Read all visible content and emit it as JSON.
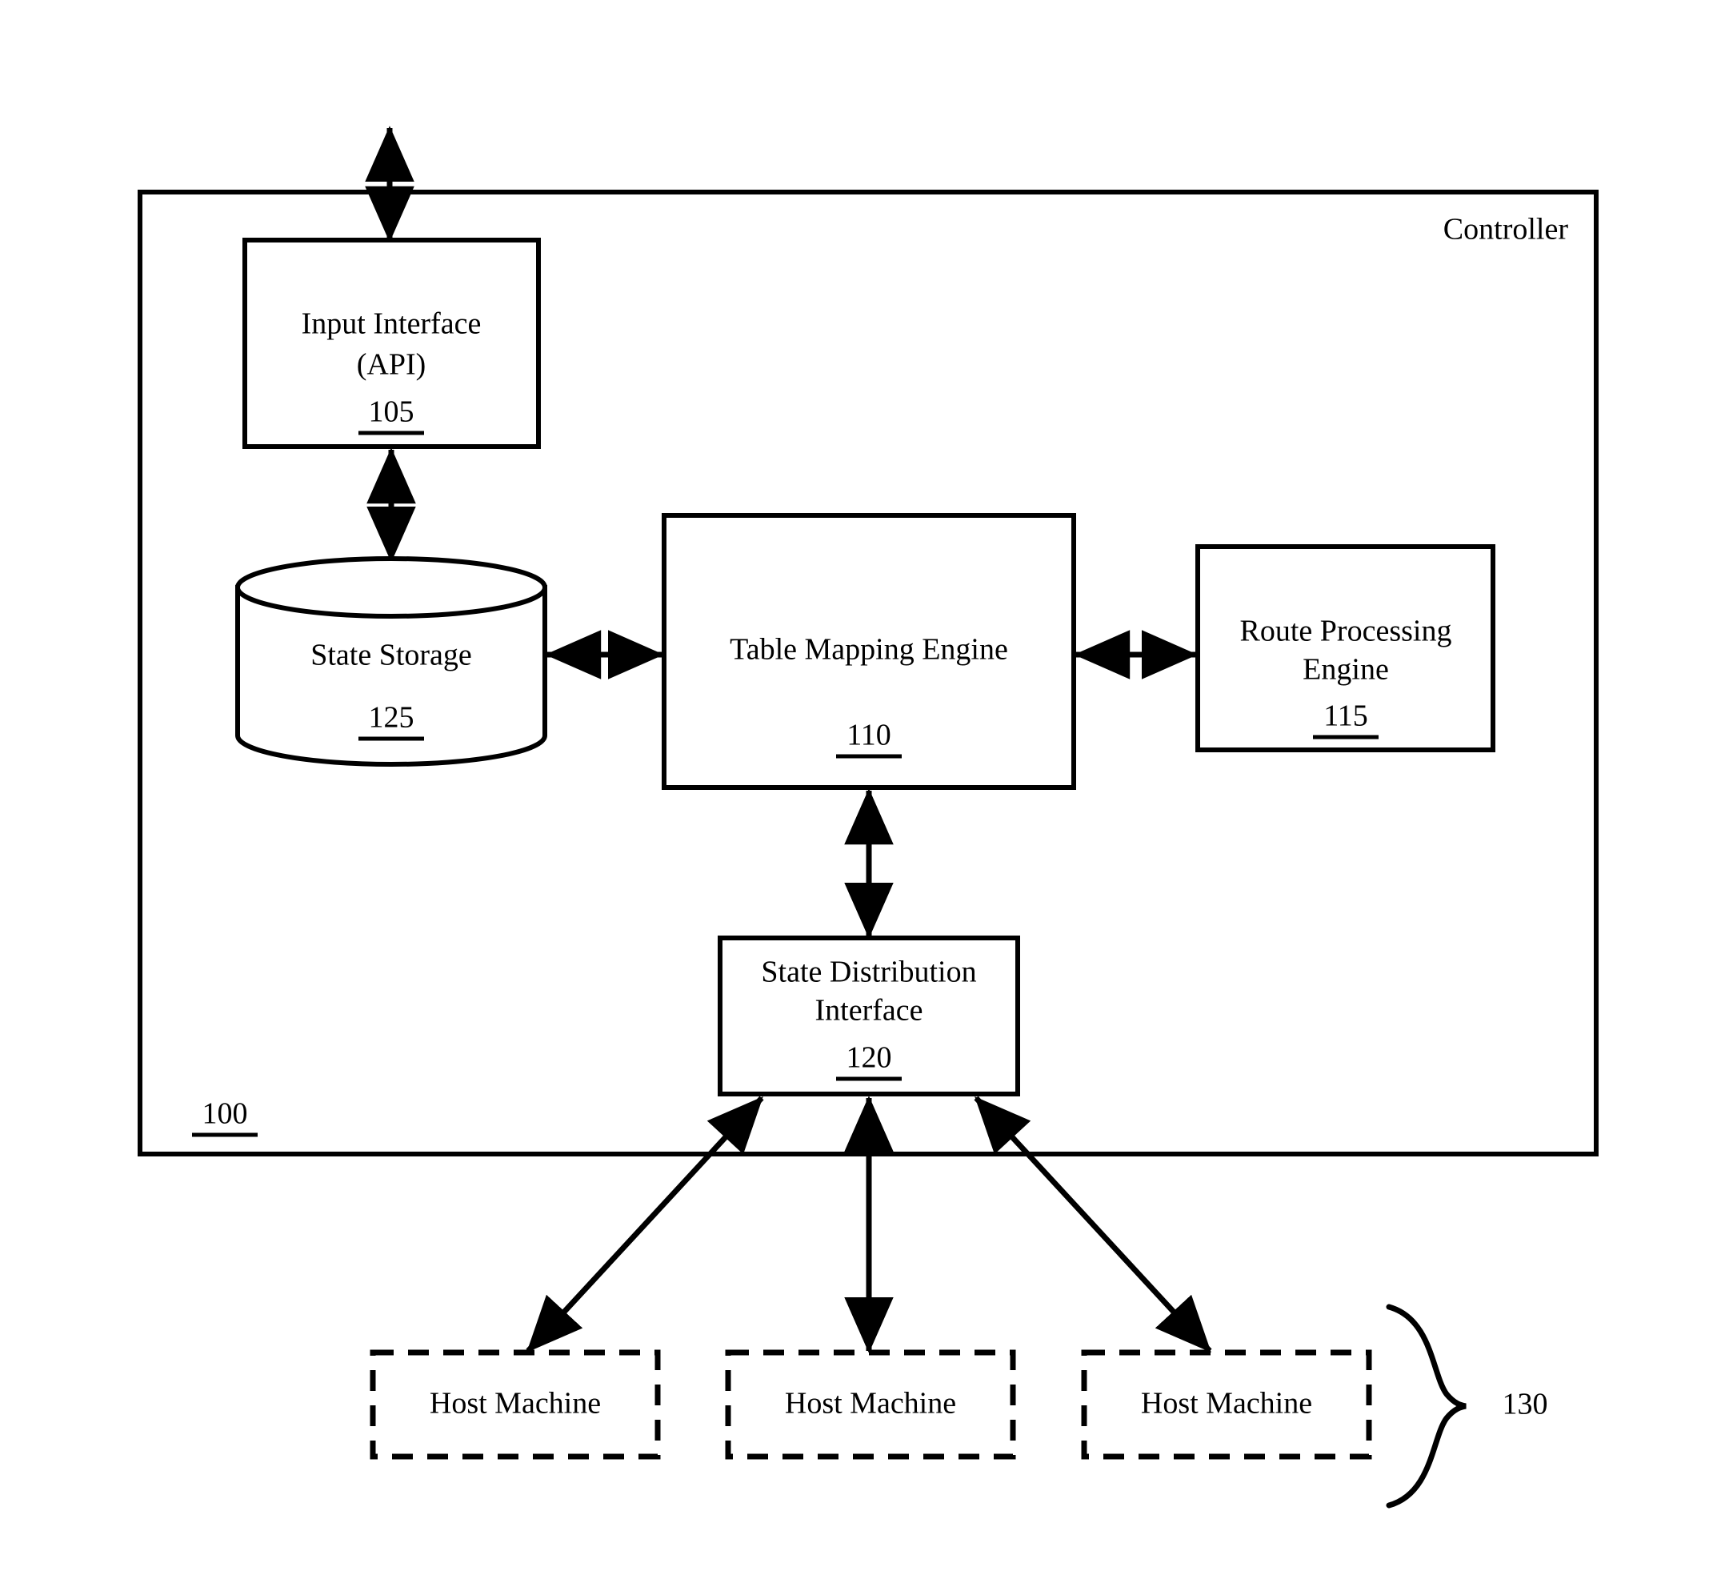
{
  "figure": {
    "title_label": "Controller",
    "system_ref": "100",
    "hosts_group_ref": "130"
  },
  "nodes": {
    "input_interface": {
      "line1": "Input Interface",
      "line2": "(API)",
      "ref": "105"
    },
    "state_storage": {
      "line1": "State Storage",
      "ref": "125"
    },
    "table_mapping_engine": {
      "line1": "Table Mapping Engine",
      "ref": "110"
    },
    "route_processing_engine": {
      "line1": "Route Processing",
      "line2": "Engine",
      "ref": "115"
    },
    "state_distribution_interface": {
      "line1": "State Distribution",
      "line2": "Interface",
      "ref": "120"
    },
    "host_machines": [
      {
        "label": "Host Machine"
      },
      {
        "label": "Host Machine"
      },
      {
        "label": "Host Machine"
      }
    ]
  },
  "colors": {
    "stroke": "#000000",
    "fill": "#ffffff"
  }
}
